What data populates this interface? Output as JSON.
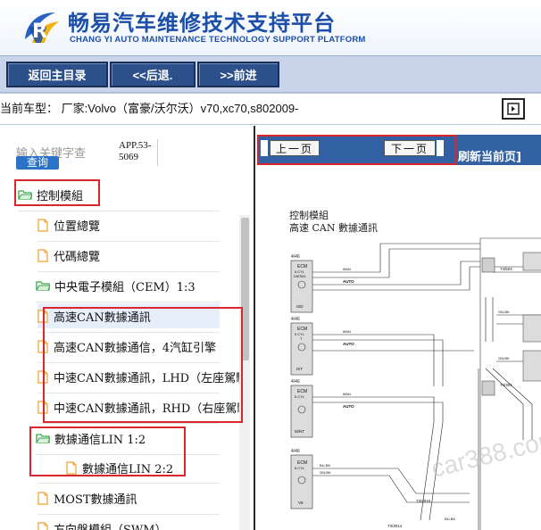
{
  "header": {
    "title_cn": "畅易汽车维修技术支持平台",
    "title_en": "CHANG YI AUTO MAINTENANCE TECHNOLOGY SUPPORT PLATFORM",
    "brand_color": "#1c4fa8"
  },
  "toolbar": {
    "home_label": "返回主目录",
    "back_label": "<<后退.",
    "forward_label": ">>前进"
  },
  "vehicle": {
    "text": "当前车型： 厂家:Volvo（富豪/沃尔沃）v70,xc70,s802009-"
  },
  "search": {
    "placeholder": "输入关键字查",
    "button_label": "查询",
    "app_code": "APP.53-5069"
  },
  "tree": {
    "items": [
      {
        "label": "控制模組",
        "icon": "folder-icon"
      },
      {
        "label": "位置總覽",
        "icon": "document-icon"
      },
      {
        "label": "代碼總覽",
        "icon": "document-icon"
      },
      {
        "label": "中央電子模組（CEM）1:3",
        "icon": "folder-icon"
      },
      {
        "label": "高速CAN數據通訊",
        "icon": "document-icon"
      },
      {
        "label": "高速CAN數據通信，4汽缸引擎",
        "icon": "document-icon"
      },
      {
        "label": "中速CAN數據通訊，LHD（左座駕駛",
        "icon": "document-icon"
      },
      {
        "label": "中速CAN數據通訊，RHD（右座駕駛",
        "icon": "document-icon"
      },
      {
        "label": "數據通信LIN 1:2",
        "icon": "folder-icon"
      },
      {
        "label": "數據通信LIN 2:2",
        "icon": "document-icon"
      },
      {
        "label": "MOST數據通訊",
        "icon": "document-icon"
      },
      {
        "label": "方向盤模組（SWM）",
        "icon": "document-icon"
      }
    ]
  },
  "pager": {
    "prev_label": "上一页",
    "next_label": "下一页",
    "refresh_label": "刷新当前页]"
  },
  "diagram": {
    "title_line1": "控制模組",
    "title_line2": "高速 CAN 數據通訊",
    "ecm_blocks": [
      {
        "ref": "4/46",
        "lines": [
          "ECM",
          "5 CYL",
          "DIESEL"
        ],
        "variant": "ISD"
      },
      {
        "ref": "4/46",
        "lines": [
          "ECM",
          "5 CYL",
          "T"
        ],
        "variant": "IST"
      },
      {
        "ref": "4/46",
        "lines": [
          "ECM",
          "6 CYL"
        ],
        "variant": "I6/NT"
      },
      {
        "ref": "4/46",
        "lines": [
          "ECM",
          "8 CYL"
        ],
        "variant": "V8"
      }
    ],
    "wire_labels": [
      "AUTO",
      "MAN",
      "BU-BK",
      "GN-BK"
    ],
    "connectors": [
      "74/504",
      "74/301",
      "73/3014",
      "73/3010"
    ],
    "watermark": "car388.com"
  }
}
